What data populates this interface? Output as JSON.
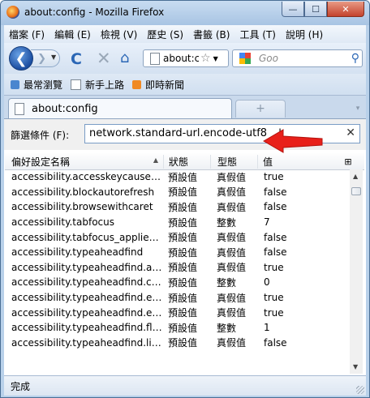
{
  "window": {
    "title": "about:config - Mozilla Firefox",
    "min_label": "—",
    "max_label": "☐",
    "close_label": "✕"
  },
  "menu": [
    "檔案 (F)",
    "編輯 (E)",
    "檢視 (V)",
    "歷史 (S)",
    "書籤 (B)",
    "工具 (T)",
    "說明 (H)"
  ],
  "nav": {
    "back_glyph": "❮",
    "forward_glyph": "❯",
    "reload_glyph": "C",
    "stop_glyph": "✕",
    "home_glyph": "⌂",
    "url": "about:config",
    "search_placeholder": "Goo",
    "star_glyph": "☆"
  },
  "bookmarks": [
    "最常瀏覽",
    "新手上路",
    "即時新聞"
  ],
  "tab": {
    "label": "about:config",
    "newtab_glyph": "+",
    "tablist_glyph": "▾"
  },
  "filter": {
    "label": "篩選條件 (F):",
    "value": "network.standard-url.encode-utf8",
    "clear_glyph": "✕",
    "cursor_glyph": "I"
  },
  "columns": {
    "name": "偏好設定名稱",
    "status": "狀態",
    "type": "型態",
    "value": "值"
  },
  "rows": [
    {
      "name": "accessibility.accesskeycausesactiv...",
      "status": "預設值",
      "type": "真假值",
      "value": "true"
    },
    {
      "name": "accessibility.blockautorefresh",
      "status": "預設值",
      "type": "真假值",
      "value": "false"
    },
    {
      "name": "accessibility.browsewithcaret",
      "status": "預設值",
      "type": "真假值",
      "value": "false"
    },
    {
      "name": "accessibility.tabfocus",
      "status": "預設值",
      "type": "整數",
      "value": "7"
    },
    {
      "name": "accessibility.tabfocus_applies_to_...",
      "status": "預設值",
      "type": "真假值",
      "value": "false"
    },
    {
      "name": "accessibility.typeaheadfind",
      "status": "預設值",
      "type": "真假值",
      "value": "false"
    },
    {
      "name": "accessibility.typeaheadfind.autos...",
      "status": "預設值",
      "type": "真假值",
      "value": "true"
    },
    {
      "name": "accessibility.typeaheadfind.cases...",
      "status": "預設值",
      "type": "整數",
      "value": "0"
    },
    {
      "name": "accessibility.typeaheadfind.enabl...",
      "status": "預設值",
      "type": "真假值",
      "value": "true"
    },
    {
      "name": "accessibility.typeaheadfind.enabl...",
      "status": "預設值",
      "type": "真假值",
      "value": "true"
    },
    {
      "name": "accessibility.typeaheadfind.flashB...",
      "status": "預設值",
      "type": "整數",
      "value": "1"
    },
    {
      "name": "accessibility.typeaheadfind.linkso...",
      "status": "預設值",
      "type": "真假值",
      "value": "false"
    }
  ],
  "status": "完成",
  "colors": {
    "arrow": "#e8201a",
    "titlebar": "#b9d1ea",
    "accent": "#2a66b5"
  }
}
